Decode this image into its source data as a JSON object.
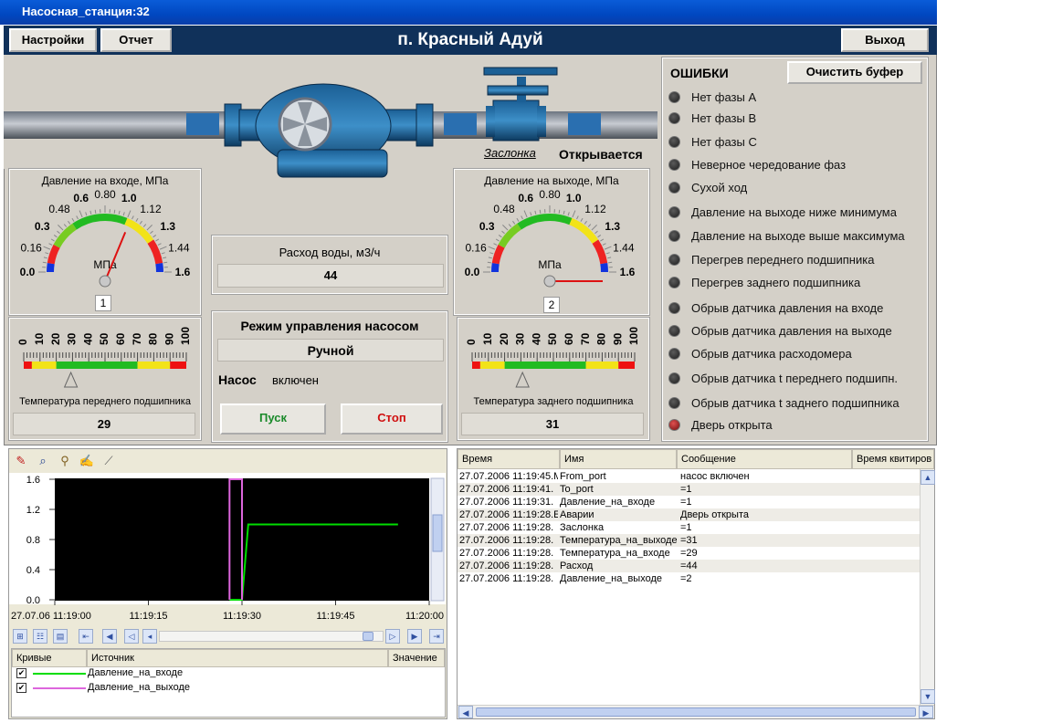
{
  "window": {
    "title": "Насосная_станция:32"
  },
  "header": {
    "settings_label": "Настройки",
    "report_label": "Отчет",
    "title": "п. Красный Адуй",
    "exit_label": "Выход"
  },
  "pipeline": {
    "valve_label": "Заслонка",
    "valve_status": "Открывается"
  },
  "gauge_in": {
    "title": "Давление на входе, МПа",
    "ticks": [
      "0.0",
      "0.16",
      "0.3",
      "0.48",
      "0.6",
      "0.80",
      "1.0",
      "1.12",
      "1.3",
      "1.44",
      "1.6"
    ],
    "unit": "МПа",
    "index": "1",
    "value": 1.0
  },
  "gauge_out": {
    "title": "Давление на выходе, МПа",
    "ticks": [
      "0.0",
      "0.16",
      "0.3",
      "0.48",
      "0.6",
      "0.80",
      "1.0",
      "1.12",
      "1.3",
      "1.44",
      "1.6"
    ],
    "unit": "МПа",
    "index": "2",
    "value": 1.6
  },
  "temp_front": {
    "ticks": [
      "0",
      "10",
      "20",
      "30",
      "40",
      "50",
      "60",
      "70",
      "80",
      "90",
      "100"
    ],
    "label": "Температура переднего подшипника",
    "value": "29"
  },
  "temp_rear": {
    "ticks": [
      "0",
      "10",
      "20",
      "30",
      "40",
      "50",
      "60",
      "70",
      "80",
      "90",
      "100"
    ],
    "label": "Температура заднего подшипника",
    "value": "31"
  },
  "flow": {
    "label": "Расход воды, м3/ч",
    "value": "44"
  },
  "control": {
    "title": "Режим управления насосом",
    "mode": "Ручной",
    "pump_label": "Насос",
    "pump_state": "включен",
    "start_label": "Пуск",
    "stop_label": "Стоп"
  },
  "errors": {
    "title": "ОШИБКИ",
    "clear_label": "Очистить буфер",
    "items": [
      {
        "label": "Нет фазы А",
        "active": false
      },
      {
        "label": "Нет фазы В",
        "active": false
      },
      {
        "label": "Нет фазы С",
        "active": false
      },
      {
        "label": "Неверное чередование фаз",
        "active": false
      },
      {
        "label": "Сухой ход",
        "active": false
      },
      {
        "label": "Давление на выходе ниже минимума",
        "active": false
      },
      {
        "label": "Давление на выходе выше максимума",
        "active": false
      },
      {
        "label": "Перегрев переднего подшипника",
        "active": false
      },
      {
        "label": "Перегрев заднего подшипника",
        "active": false
      },
      {
        "label": "Обрыв датчика давления на входе",
        "active": false
      },
      {
        "label": "Обрыв датчика давления на выходе",
        "active": false
      },
      {
        "label": "Обрыв датчика расходомера",
        "active": false
      },
      {
        "label": "Обрыв датчика t переднего подшипн.",
        "active": false
      },
      {
        "label": "Обрыв датчика t заднего подшипника",
        "active": false
      },
      {
        "label": "Дверь открыта",
        "active": true
      }
    ]
  },
  "trend": {
    "toolbar_icons": [
      "pen-icon",
      "magnifier-icon",
      "stamp-icon",
      "notepad-icon",
      "ruler-icon"
    ],
    "y_ticks": [
      "1.6",
      "1.2",
      "0.8",
      "0.4",
      "0.0"
    ],
    "x_ticks": [
      "27.07.06 11:19:00",
      "11:19:15",
      "11:19:30",
      "11:19:45",
      "11:20:00"
    ],
    "legend_headers": {
      "curves": "Кривые",
      "source": "Источник",
      "value": "Значение"
    },
    "legend": [
      {
        "name": "Давление_на_входе",
        "color": "#00dd00"
      },
      {
        "name": "Давление_на_выходе",
        "color": "#dd66dd"
      }
    ]
  },
  "chart_data": {
    "type": "line",
    "x_range": [
      "11:19:00",
      "11:20:00"
    ],
    "ylim": [
      0,
      1.6
    ],
    "grid": false,
    "series": [
      {
        "name": "Давление_на_входе",
        "color": "#00dd00",
        "points": [
          [
            "11:19:28",
            0.0
          ],
          [
            "11:19:30",
            0.0
          ],
          [
            "11:19:31",
            1.0
          ],
          [
            "11:19:55",
            1.0
          ]
        ]
      },
      {
        "name": "Давление_на_выходе",
        "color": "#dd66dd",
        "points": [
          [
            "11:19:28",
            0.0
          ],
          [
            "11:19:28",
            1.6
          ],
          [
            "11:19:30",
            1.6
          ],
          [
            "11:19:30",
            0.0
          ]
        ]
      }
    ]
  },
  "events": {
    "headers": [
      "Время",
      "Имя",
      "Сообщение",
      "Время квитиров"
    ],
    "rows": [
      [
        "27.07.2006 11:19:45.M",
        "From_port",
        "насос включен"
      ],
      [
        "27.07.2006 11:19:41.",
        "To_port",
        "=1"
      ],
      [
        "27.07.2006 11:19:31.",
        "Давление_на_входе",
        "=1"
      ],
      [
        "27.07.2006 11:19:28.E",
        "Аварии",
        "Дверь открыта"
      ],
      [
        "27.07.2006 11:19:28.",
        "Заслонка",
        "=1"
      ],
      [
        "27.07.2006 11:19:28.",
        "Температура_на_выходе",
        "=31"
      ],
      [
        "27.07.2006 11:19:28.",
        "Температура_на_входе",
        "=29"
      ],
      [
        "27.07.2006 11:19:28.",
        "Расход",
        "=44"
      ],
      [
        "27.07.2006 11:19:28.",
        "Давление_на_выходе",
        "=2"
      ]
    ]
  }
}
